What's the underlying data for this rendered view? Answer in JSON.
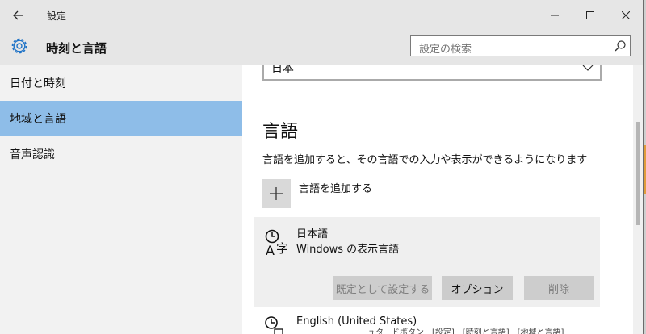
{
  "titlebar": {
    "title": "設定"
  },
  "header": {
    "section_title": "時刻と言語",
    "search_placeholder": "設定の検索"
  },
  "sidebar": {
    "items": [
      {
        "label": "日付と時刻"
      },
      {
        "label": "地域と言語"
      },
      {
        "label": "音声認識"
      }
    ]
  },
  "content": {
    "region_dropdown_value": "日本",
    "languages_heading": "言語",
    "languages_desc": "言語を追加すると、その言語での入力や表示ができるようになります",
    "add_language_label": "言語を追加する",
    "languages": [
      {
        "name": "日本語",
        "subtitle": "Windows の表示言語"
      },
      {
        "name": "English (United States)"
      }
    ],
    "buttons": {
      "set_default": "既定として設定する",
      "options": "オプション",
      "remove": "削除"
    }
  },
  "background_window": {
    "text": "ュタ　ドボタン　[設定]　[時刻と言語]　[地域と言語]"
  },
  "colors": {
    "accent_selected": "#8ebde8",
    "gear_blue": "#1f73c7"
  }
}
